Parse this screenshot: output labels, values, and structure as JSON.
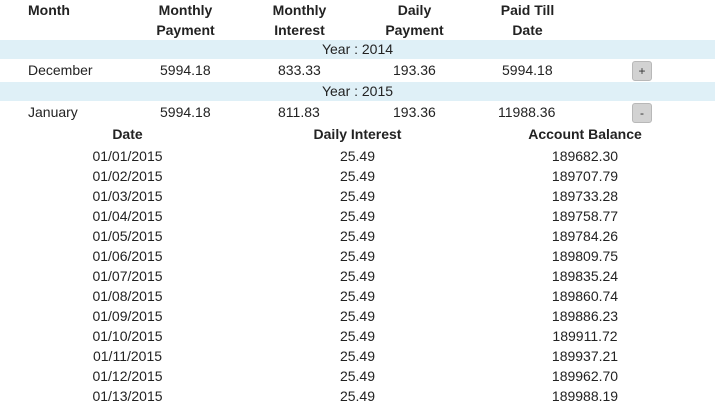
{
  "headers": {
    "month": "Month",
    "monthly_payment": [
      "Monthly",
      "Payment"
    ],
    "monthly_interest": [
      "Monthly",
      "Interest"
    ],
    "daily_payment": [
      "Daily",
      "Payment"
    ],
    "paid_till_date": [
      "Paid Till",
      "Date"
    ]
  },
  "years": [
    {
      "label": "Year : 2014",
      "row": {
        "month": "December",
        "monthly_payment": "5994.18",
        "monthly_interest": "833.33",
        "daily_payment": "193.36",
        "paid_till_date": "5994.18",
        "toggle": "+"
      }
    },
    {
      "label": "Year : 2015",
      "row": {
        "month": "January",
        "monthly_payment": "5994.18",
        "monthly_interest": "811.83",
        "daily_payment": "193.36",
        "paid_till_date": "11988.36",
        "toggle": "-"
      }
    }
  ],
  "detail_headers": {
    "date": "Date",
    "daily_interest": "Daily Interest",
    "account_balance": "Account Balance"
  },
  "detail_rows": [
    {
      "date": "01/01/2015",
      "interest": "25.49",
      "balance": "189682.30"
    },
    {
      "date": "01/02/2015",
      "interest": "25.49",
      "balance": "189707.79"
    },
    {
      "date": "01/03/2015",
      "interest": "25.49",
      "balance": "189733.28"
    },
    {
      "date": "01/04/2015",
      "interest": "25.49",
      "balance": "189758.77"
    },
    {
      "date": "01/05/2015",
      "interest": "25.49",
      "balance": "189784.26"
    },
    {
      "date": "01/06/2015",
      "interest": "25.49",
      "balance": "189809.75"
    },
    {
      "date": "01/07/2015",
      "interest": "25.49",
      "balance": "189835.24"
    },
    {
      "date": "01/08/2015",
      "interest": "25.49",
      "balance": "189860.74"
    },
    {
      "date": "01/09/2015",
      "interest": "25.49",
      "balance": "189886.23"
    },
    {
      "date": "01/10/2015",
      "interest": "25.49",
      "balance": "189911.72"
    },
    {
      "date": "01/11/2015",
      "interest": "25.49",
      "balance": "189937.21"
    },
    {
      "date": "01/12/2015",
      "interest": "25.49",
      "balance": "189962.70"
    },
    {
      "date": "01/13/2015",
      "interest": "25.49",
      "balance": "189988.19"
    }
  ]
}
